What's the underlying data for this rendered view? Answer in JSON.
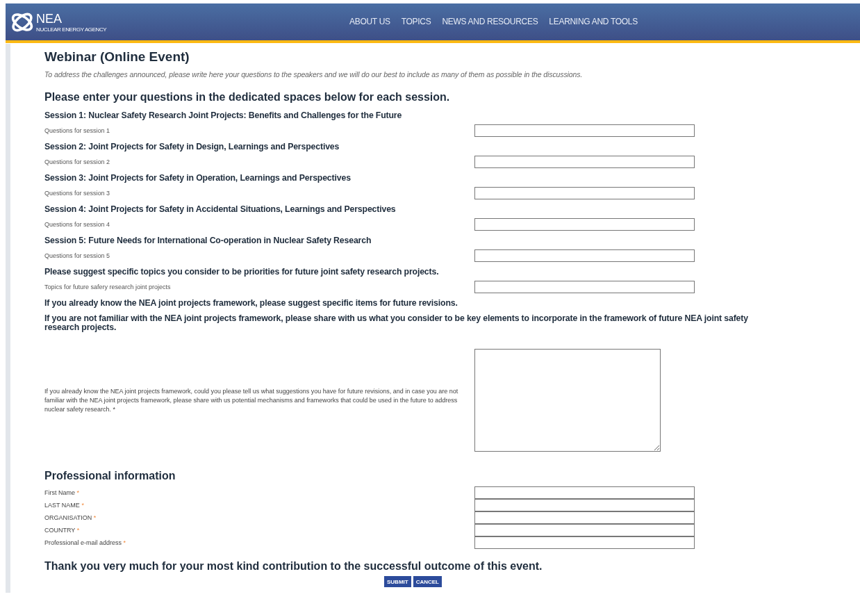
{
  "header": {
    "logo": {
      "name": "NEA",
      "subtitle": "NUCLEAR ENERGY AGENCY"
    },
    "nav": [
      {
        "label": "ABOUT US"
      },
      {
        "label": "TOPICS"
      },
      {
        "label": "NEWS AND RESOURCES"
      },
      {
        "label": "LEARNING AND TOOLS"
      }
    ]
  },
  "page": {
    "title": "Webinar (Online Event)",
    "intro": "To address the challenges announced, please write here your questions to the speakers and we will do our best to include as many of them as possible in the discussions.",
    "instructions": "Please enter your questions in the dedicated spaces below for each session."
  },
  "form": {
    "items": [
      {
        "kind": "heading",
        "text": "Session 1: Nuclear Safety Research Joint Projects: Benefits and Challenges for the Future"
      },
      {
        "kind": "text_field",
        "label": "Questions for session 1"
      },
      {
        "kind": "heading",
        "text": "Session 2: Joint Projects for Safety in Design, Learnings and Perspectives"
      },
      {
        "kind": "text_field",
        "label": "Questions for session 2"
      },
      {
        "kind": "heading",
        "text": "Session 3: Joint Projects for Safety in Operation, Learnings and Perspectives"
      },
      {
        "kind": "text_field",
        "label": "Questions for session 3"
      },
      {
        "kind": "heading",
        "text": "Session 4: Joint Projects for Safety in Accidental Situations, Learnings and Perspectives"
      },
      {
        "kind": "text_field",
        "label": "Questions for session 4"
      },
      {
        "kind": "heading",
        "text": "Session 5: Future Needs for International Co-operation in Nuclear Safety Research"
      },
      {
        "kind": "text_field",
        "label": "Questions for session 5"
      },
      {
        "kind": "heading",
        "text": "Please suggest specific topics you consider to be priorities for future joint safety research projects."
      },
      {
        "kind": "text_field",
        "label": "Topics for future safery research joint projects"
      },
      {
        "kind": "heading",
        "text": "If you already know the NEA joint projects framework, please suggest specific items for future revisions."
      },
      {
        "kind": "heading",
        "text": "If you are not familiar with the NEA joint projects framework, please share with us what you consider to be key elements to incorporate in the framework of future NEA joint safety research projects."
      },
      {
        "kind": "text_area",
        "label": "If you already know the NEA joint projects framework, could you please tell us what suggestions you have for future revisions, and in case you are not familiar with the NEA joint projects framework, please share with us potential mechanisms and frameworks that could be used in the future to address nuclear safety research. *"
      }
    ]
  },
  "professional": {
    "title": "Professional information",
    "fields": [
      {
        "label": "First Name",
        "required_mark": "*"
      },
      {
        "label": "LAST NAME",
        "required_mark": "*"
      },
      {
        "label": "ORGANISATION",
        "required_mark": "*"
      },
      {
        "label": "COUNTRY",
        "required_mark": "*"
      },
      {
        "label": "Professional e-mail address",
        "required_mark": "*"
      }
    ]
  },
  "thanks": "Thank you very much for your most kind contribution to the successful outcome of this event.",
  "buttons": [
    {
      "label": "SUBMIT"
    },
    {
      "label": "CANCEL"
    }
  ]
}
